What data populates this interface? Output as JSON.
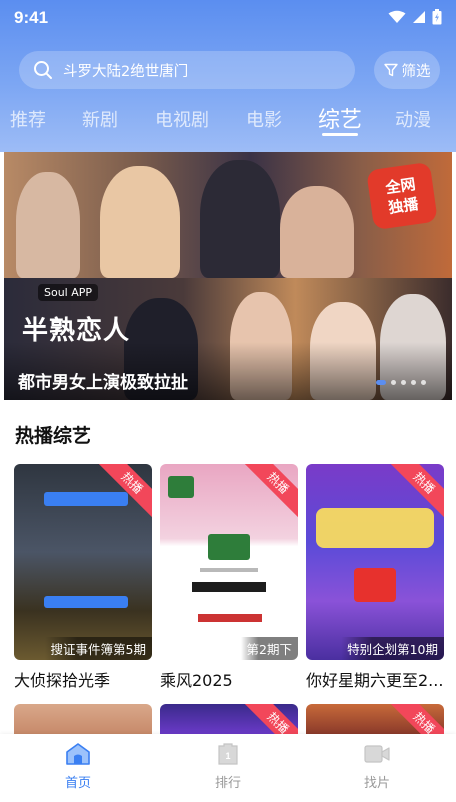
{
  "status_bar": {
    "time": "9:41"
  },
  "search": {
    "query": "斗罗大陆2绝世唐门"
  },
  "filter": {
    "label": "筛选"
  },
  "tabs": [
    {
      "label": "推荐"
    },
    {
      "label": "新剧"
    },
    {
      "label": "电视剧"
    },
    {
      "label": "电影"
    },
    {
      "label": "综艺",
      "active": true
    },
    {
      "label": "动漫"
    }
  ],
  "banner": {
    "caption": "都市男女上演极致拉扯",
    "badge_line1": "全网",
    "badge_line2": "独播",
    "app_tag": "Soul APP",
    "show_logo": "半熟恋人",
    "page_count": 5,
    "active_page": 1
  },
  "section": {
    "title": "热播综艺"
  },
  "cards": [
    {
      "title": "大侦探拾光季",
      "subtitle": "搜证事件簿第5期",
      "badge": "热播"
    },
    {
      "title": "乘风2025",
      "subtitle": "第2期下",
      "badge": "热播"
    },
    {
      "title": "你好星期六更至2...",
      "subtitle": "特别企划第10期",
      "badge": "热播"
    }
  ],
  "row2_badges": [
    "热播",
    "热播"
  ],
  "nav": {
    "home": "首页",
    "rank": "排行",
    "film": "找片"
  },
  "colors": {
    "accent": "#3a7ff2",
    "header_top": "#5b8ef0",
    "hot_badge": "#f2475a"
  }
}
